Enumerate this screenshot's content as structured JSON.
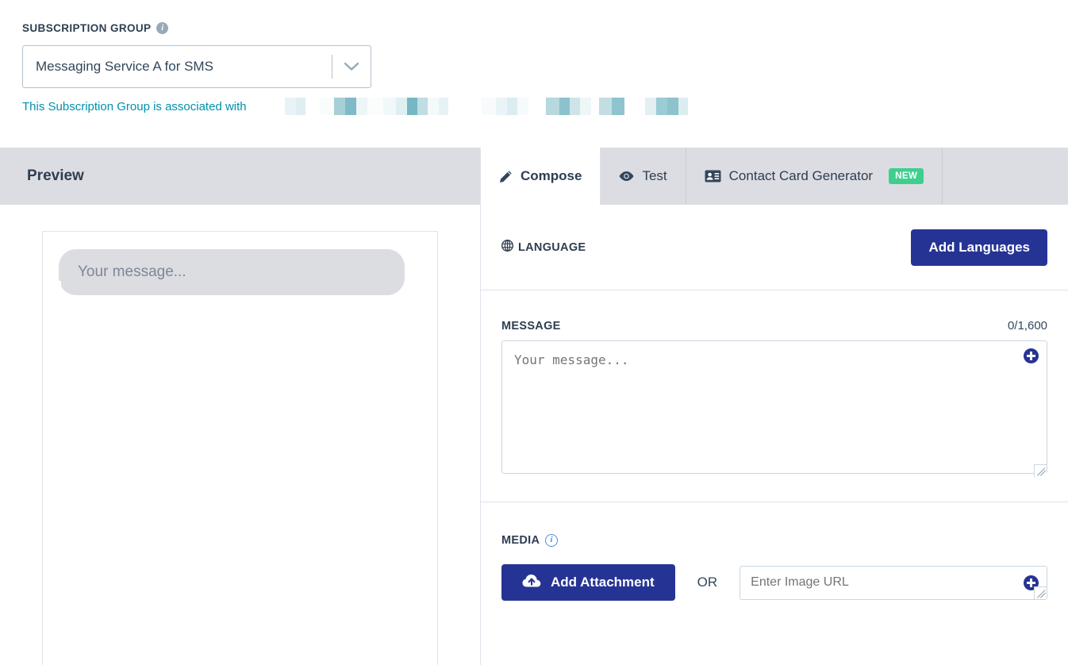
{
  "subscription": {
    "label": "SUBSCRIPTION GROUP",
    "info_icon": "info-icon",
    "selected_value": "Messaging Service A for SMS",
    "caret_icon": "chevron-down-icon",
    "association_text": "This Subscription Group is associated with",
    "association_redacted": true,
    "link_color": "#0091ae"
  },
  "preview": {
    "title": "Preview",
    "bubble_text": "Your message...",
    "header_bg": "#dcdde3",
    "bubble_bg": "#dcdde1"
  },
  "tabs": [
    {
      "id": "compose",
      "label": "Compose",
      "icon": "pencil-icon",
      "active": true,
      "badge": ""
    },
    {
      "id": "test",
      "label": "Test",
      "icon": "eye-icon",
      "active": false,
      "badge": ""
    },
    {
      "id": "contact-card-generator",
      "label": "Contact Card Generator",
      "icon": "contact-card-icon",
      "active": false,
      "badge": "NEW"
    }
  ],
  "badge_color": "#3ecf8e",
  "language": {
    "label": "LANGUAGE",
    "icon": "globe-icon",
    "add_button_label": "Add Languages",
    "button_color": "#253494"
  },
  "message": {
    "label": "MESSAGE",
    "counter": "0/1,600",
    "placeholder": "Your message...",
    "value": "",
    "add_token_icon": "plus-circle-icon"
  },
  "media": {
    "label": "MEDIA",
    "info_icon": "info-icon",
    "attachment_button_label": "Add Attachment",
    "attachment_icon": "cloud-upload-icon",
    "or_label": "OR",
    "url_placeholder": "Enter Image URL",
    "url_value": "",
    "add_token_icon": "plus-circle-icon"
  }
}
